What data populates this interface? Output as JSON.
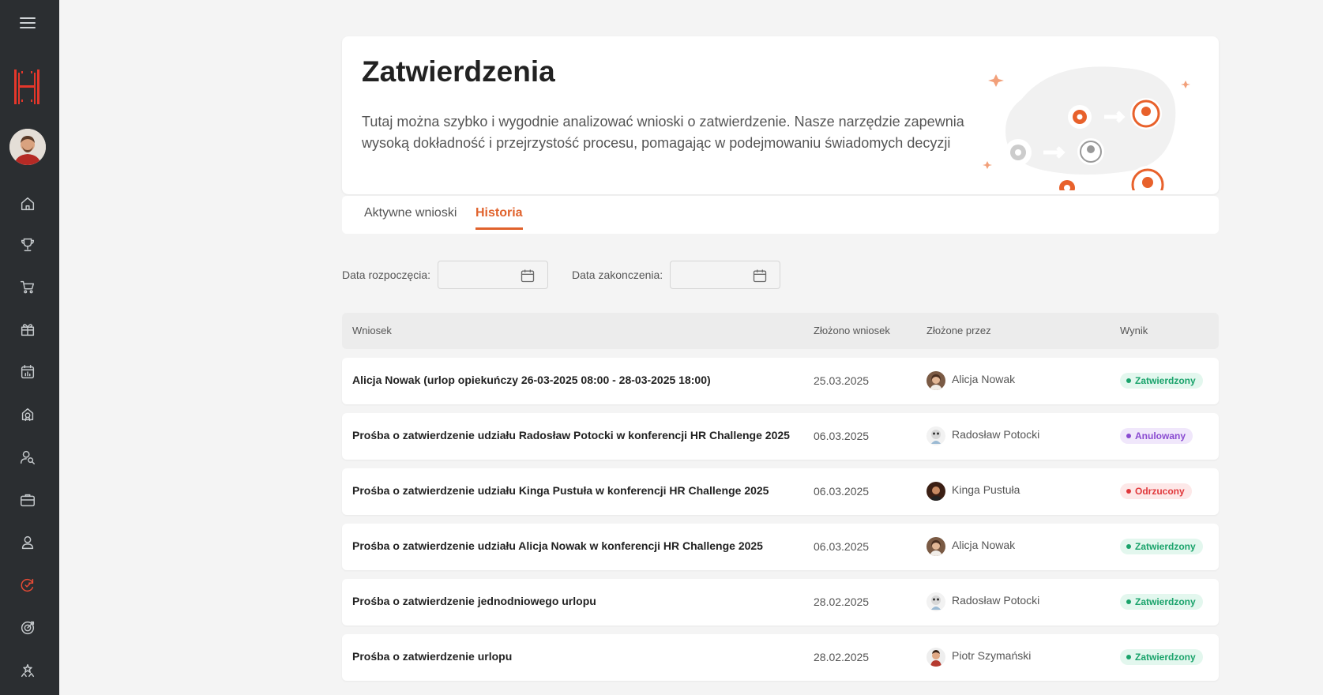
{
  "header": {
    "title": "Zatwierdzenia",
    "description": "Tutaj można szybko i wygodnie analizować wnioski o zatwierdzenie. Nasze narzędzie zapewnia wysoką dokładność i przejrzystość procesu, pomagając w podejmowaniu świadomych decyzji"
  },
  "tabs": [
    {
      "label": "Aktywne wnioski",
      "active": false
    },
    {
      "label": "Historia",
      "active": true
    }
  ],
  "filters": {
    "start_label": "Data rozpoczęcia:",
    "end_label": "Data zakonczenia:"
  },
  "table": {
    "columns": [
      "Wniosek",
      "Złożono wniosek",
      "Złożone przez",
      "Wynik"
    ],
    "rows": [
      {
        "title": "Alicja Nowak (urlop opiekuńczy 26-03-2025 08:00 - 28-03-2025 18:00)",
        "date": "25.03.2025",
        "by": "Alicja Nowak",
        "avatar": "avatar-alicja",
        "status": "Zatwierdzony"
      },
      {
        "title": "Prośba o zatwierdzenie udziału Radosław Potocki w konferencji HR Challenge 2025",
        "date": "06.03.2025",
        "by": "Radosław Potocki",
        "avatar": "avatar-radoslaw",
        "status": "Anulowany"
      },
      {
        "title": "Prośba o zatwierdzenie udziału Kinga Pustuła w konferencji HR Challenge 2025",
        "date": "06.03.2025",
        "by": "Kinga Pustuła",
        "avatar": "avatar-kinga",
        "status": "Odrzucony"
      },
      {
        "title": "Prośba o zatwierdzenie udziału Alicja Nowak w konferencji HR Challenge 2025",
        "date": "06.03.2025",
        "by": "Alicja Nowak",
        "avatar": "avatar-alicja",
        "status": "Zatwierdzony"
      },
      {
        "title": "Prośba o zatwierdzenie jednodniowego urlopu",
        "date": "28.02.2025",
        "by": "Radosław Potocki",
        "avatar": "avatar-radoslaw",
        "status": "Zatwierdzony"
      },
      {
        "title": "Prośba o zatwierdzenie urlopu",
        "date": "28.02.2025",
        "by": "Piotr Szymański",
        "avatar": "avatar-piotr",
        "status": "Zatwierdzony"
      }
    ]
  },
  "sidebar": {
    "items": [
      "home-icon",
      "trophy-icon",
      "cart-icon",
      "gift-icon",
      "calendar-chart-icon",
      "award-icon",
      "user-search-icon",
      "briefcase-icon",
      "person-icon",
      "approvals-icon",
      "target-icon",
      "stars-icon"
    ],
    "active": "approvals-icon"
  },
  "colors": {
    "accent": "#e0622c",
    "sidebar_bg": "#2b2e31",
    "approved": "#1aa36b",
    "cancelled": "#8a4bd1",
    "rejected": "#e0383b"
  }
}
